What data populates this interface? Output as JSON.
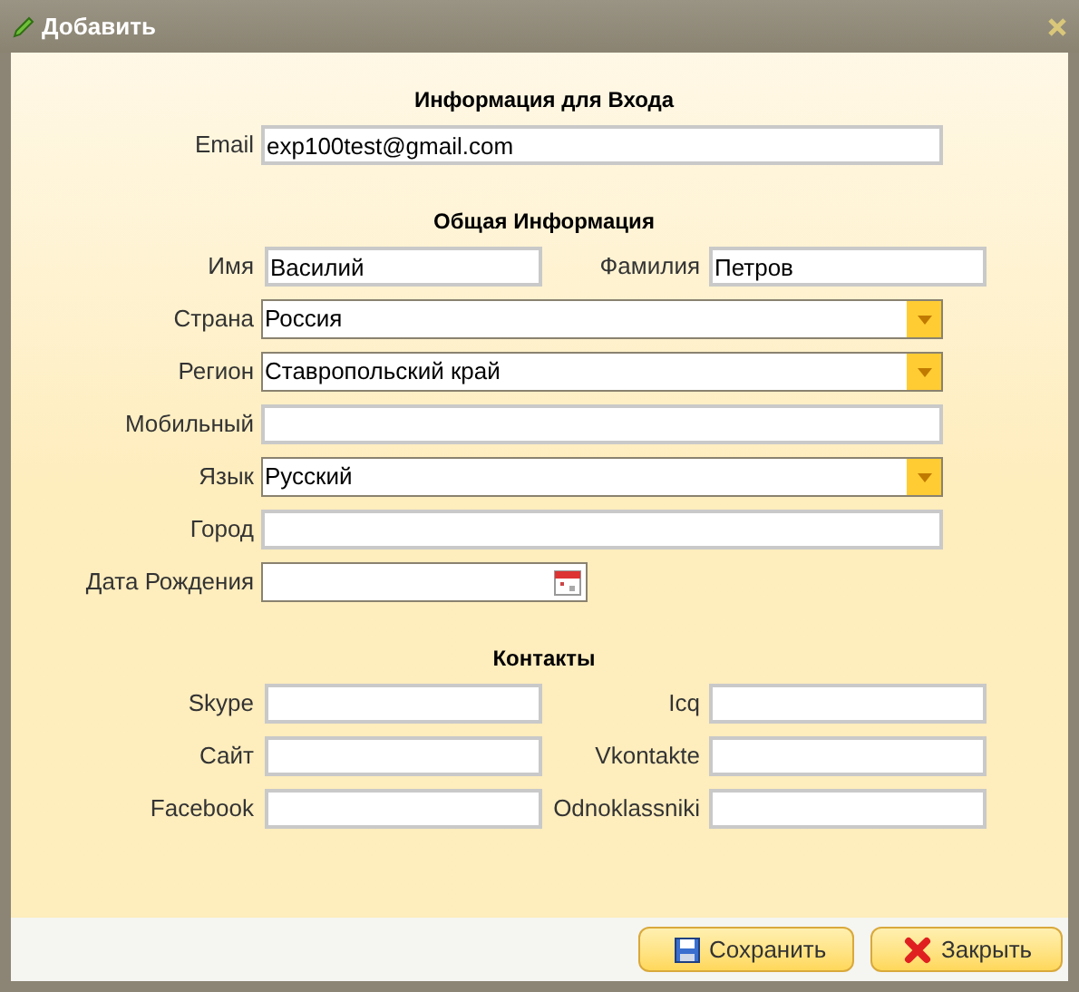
{
  "window": {
    "title": "Добавить"
  },
  "sections": [
    {
      "heading": "Информация для Входа",
      "rows": [
        [
          {
            "label": "Email",
            "kind": "text",
            "value": "exp100test@gmail.com"
          }
        ]
      ]
    },
    {
      "heading": "Общая Информация",
      "rows": [
        [
          {
            "label": "Имя",
            "kind": "text",
            "value": "Василий"
          },
          {
            "label": "Фамилия",
            "kind": "text",
            "value": "Петров"
          }
        ],
        [
          {
            "label": "Страна",
            "kind": "select",
            "value": "Россия"
          }
        ],
        [
          {
            "label": "Регион",
            "kind": "select",
            "value": "Ставропольский край"
          }
        ],
        [
          {
            "label": "Мобильный",
            "kind": "text"
          }
        ],
        [
          {
            "label": "Язык",
            "kind": "select",
            "value": "Русский"
          }
        ],
        [
          {
            "label": "Город",
            "kind": "text"
          }
        ],
        [
          {
            "label": "Дата Рождения",
            "kind": "date"
          }
        ]
      ]
    },
    {
      "heading": "Контакты",
      "rows": [
        [
          {
            "label": "Skype",
            "kind": "text"
          },
          {
            "label": "Icq",
            "kind": "text"
          }
        ],
        [
          {
            "label": "Сайт",
            "kind": "text"
          },
          {
            "label": "Vkontakte",
            "kind": "text"
          }
        ],
        [
          {
            "label": "Facebook",
            "kind": "text"
          },
          {
            "label": "Odnoklassniki",
            "kind": "text"
          }
        ]
      ]
    }
  ],
  "buttons": [
    {
      "label": "Сохранить",
      "kind": "save"
    },
    {
      "label": "Закрыть",
      "kind": "close"
    }
  ]
}
